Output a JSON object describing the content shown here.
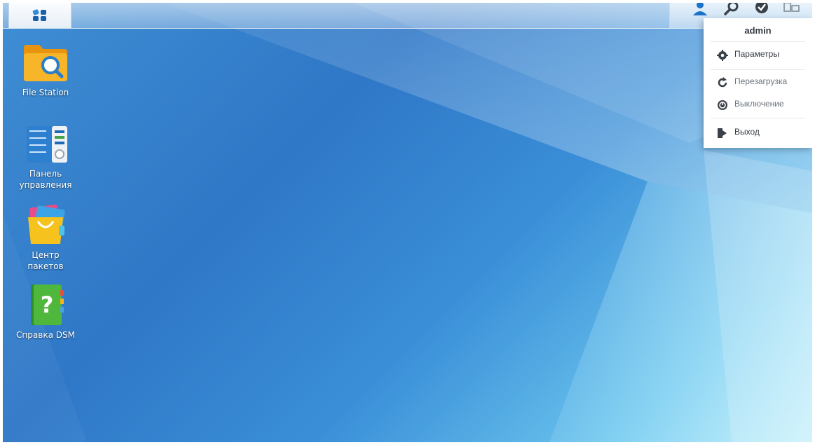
{
  "taskbar": {
    "main_menu_icon": "grid-icon",
    "tray_icons": [
      "user-icon",
      "search-icon",
      "widget-icon",
      "windows-icon"
    ]
  },
  "desktop": {
    "icons": [
      {
        "label": "File Station",
        "icon": "file-station-icon"
      },
      {
        "label": "Панель управления",
        "line1": "Панель",
        "line2": "управления",
        "icon": "control-panel-icon"
      },
      {
        "label": "Центр пакетов",
        "line1": "Центр",
        "line2": "пакетов",
        "icon": "package-center-icon"
      },
      {
        "label": "Справка DSM",
        "icon": "dsm-help-icon"
      }
    ]
  },
  "user_menu": {
    "username": "admin",
    "items": [
      {
        "label": "Параметры",
        "icon": "gear-icon"
      },
      {
        "label": "Перезагрузка",
        "icon": "restart-icon"
      },
      {
        "label": "Выключение",
        "icon": "power-icon"
      },
      {
        "label": "Выход",
        "icon": "logout-icon"
      }
    ]
  },
  "colors": {
    "accent": "#1a73c9",
    "wallpaper_dark": "#2f77c7",
    "wallpaper_light": "#a9e6f7"
  }
}
